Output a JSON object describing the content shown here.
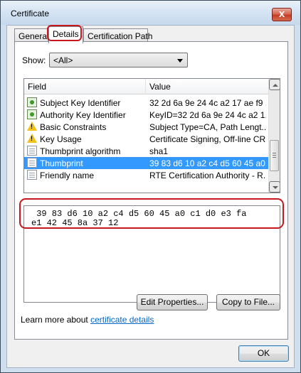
{
  "window": {
    "title": "Certificate",
    "close_label": "x"
  },
  "tabs": [
    {
      "label": "General",
      "active": false
    },
    {
      "label": "Details",
      "active": true
    },
    {
      "label": "Certification Path",
      "active": false
    }
  ],
  "show": {
    "label": "Show:",
    "value": "<All>"
  },
  "list": {
    "columns": [
      "Field",
      "Value"
    ],
    "rows": [
      {
        "field": "Subject Key Identifier",
        "value": "32 2d 6a 9e 24 4c a2 17 ae f9 ...",
        "icon": "certificate-green-icon",
        "selected": false
      },
      {
        "field": "Authority Key Identifier",
        "value": "KeyID=32 2d 6a 9e 24 4c a2 1...",
        "icon": "certificate-green-icon",
        "selected": false
      },
      {
        "field": "Basic Constraints",
        "value": "Subject Type=CA, Path Lengt...",
        "icon": "warning-icon",
        "selected": false
      },
      {
        "field": "Key Usage",
        "value": "Certificate Signing, Off-line CR...",
        "icon": "warning-icon",
        "selected": false
      },
      {
        "field": "Thumbprint algorithm",
        "value": "sha1",
        "icon": "document-icon",
        "selected": false
      },
      {
        "field": "Thumbprint",
        "value": "39 83 d6 10 a2 c4 d5 60 45 a0...",
        "icon": "document-icon",
        "selected": true
      },
      {
        "field": "Friendly name",
        "value": "RTE Certification Authority - R...",
        "icon": "document-icon",
        "selected": false
      }
    ]
  },
  "detail": {
    "line1": " 39 83 d6 10 a2 c4 d5 60 45 a0 c1 d0 e3 fa",
    "line2": "e1 42 45 8a 37 12"
  },
  "buttons": {
    "edit_properties": "Edit Properties...",
    "copy_to_file": "Copy to File...",
    "ok": "OK"
  },
  "learn_more": {
    "prefix": "Learn more about ",
    "link": "certificate details"
  },
  "colors": {
    "selection": "#3399ff",
    "highlight": "#c8161d",
    "link": "#0066cc"
  }
}
